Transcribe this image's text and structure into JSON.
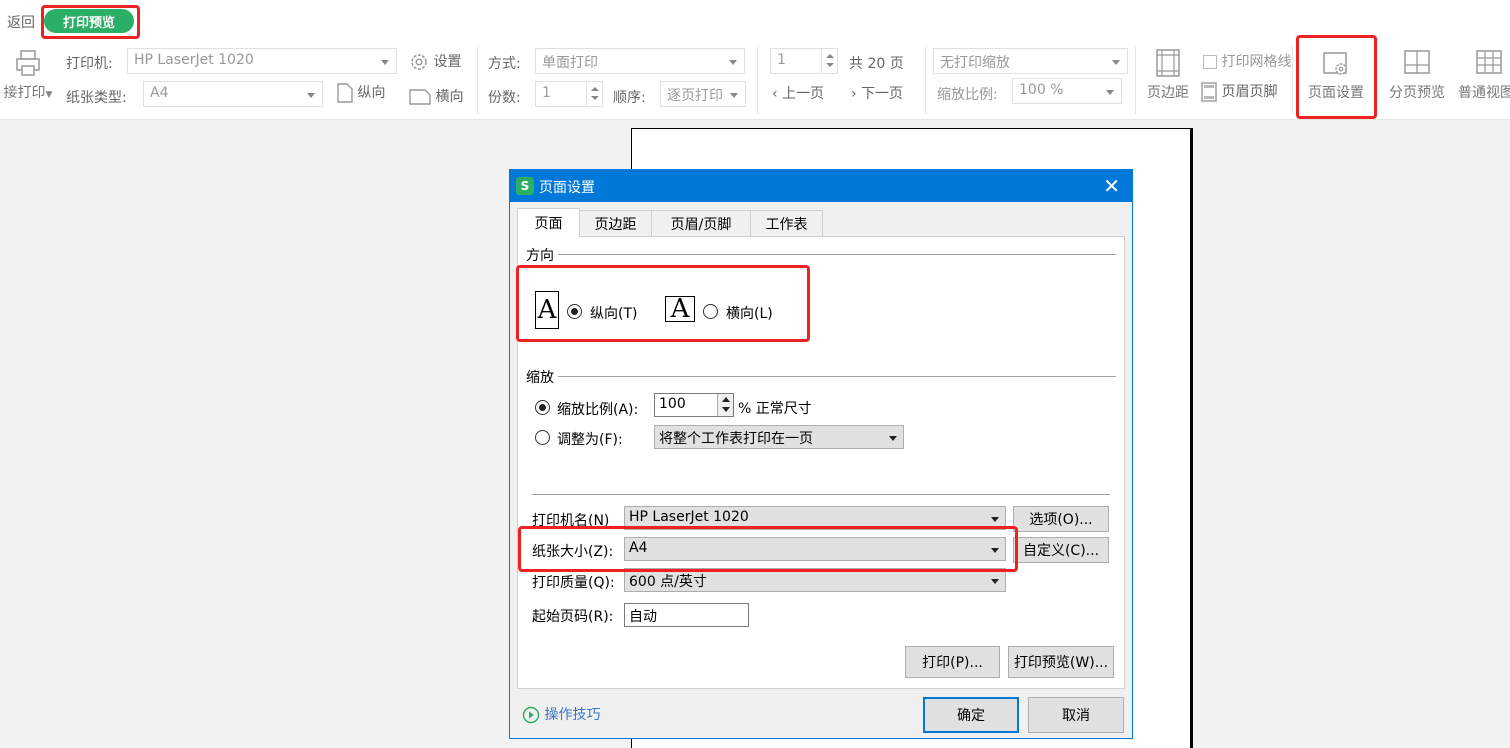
{
  "toolbar": {
    "back": "返回",
    "print_preview_pill": "打印预览",
    "direct_print": "接打印",
    "printer_label": "打印机:",
    "printer_value": "HP LaserJet 1020",
    "settings": "设置",
    "paper_type_label": "纸张类型:",
    "paper_type_value": "A4",
    "portrait": "纵向",
    "landscape": "横向",
    "mode_label": "方式:",
    "mode_value": "单面打印",
    "copies_label": "份数:",
    "copies_value": "1",
    "order_label": "顺序:",
    "order_value": "逐页打印",
    "page_value": "1",
    "page_total": "共 20 页",
    "prev_page": "上一页",
    "next_page": "下一页",
    "scale_mode_value": "无打印缩放",
    "scale_ratio_label": "缩放比例:",
    "scale_ratio_value": "100 %",
    "margins": "页边距",
    "print_gridlines": "打印网格线",
    "header_footer": "页眉页脚",
    "page_setup": "页面设置",
    "page_break_preview": "分页预览",
    "normal_view": "普通视图"
  },
  "dialog": {
    "logo": "S",
    "title": "页面设置",
    "close": "✕",
    "tabs": [
      "页面",
      "页边距",
      "页眉/页脚",
      "工作表"
    ],
    "orientation_title": "方向",
    "portrait_label": "纵向(T)",
    "landscape_label": "横向(L)",
    "orientation_icon_letter": "A",
    "scale_title": "缩放",
    "scale_ratio_label": "缩放比例(A):",
    "scale_ratio_value": "100",
    "scale_unit": "% 正常尺寸",
    "fit_label": "调整为(F):",
    "fit_value": "将整个工作表打印在一页",
    "printer_name_label": "打印机名(N)",
    "printer_name_value": "HP LaserJet 1020",
    "options_button": "选项(O)...",
    "paper_size_label": "纸张大小(Z):",
    "paper_size_value": "A4",
    "custom_button": "自定义(C)...",
    "print_quality_label": "打印质量(Q):",
    "print_quality_value": "600 点/英寸",
    "start_page_label": "起始页码(R):",
    "start_page_value": "自动",
    "print_button": "打印(P)...",
    "preview_button": "打印预览(W)...",
    "tips_link": "操作技巧",
    "ok_button": "确定",
    "cancel_button": "取消"
  },
  "colors": {
    "accent_green": "#2bae66",
    "dialog_blue": "#0078d7",
    "highlight_red": "#ee2222"
  }
}
